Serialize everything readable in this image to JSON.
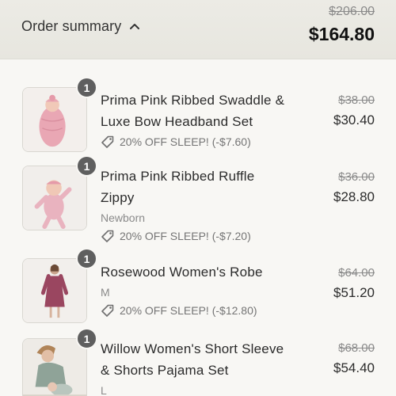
{
  "header": {
    "summary_label": "Order summary",
    "original_total": "$206.00",
    "total": "$164.80"
  },
  "items": [
    {
      "quantity": "1",
      "name_line1": "Prima Pink Ribbed Swaddle &",
      "name_line2": "Luxe Bow Headband Set",
      "variant": "",
      "discount": "20% OFF SLEEP! (-$7.60)",
      "original_price": "$38.00",
      "price": "$30.40"
    },
    {
      "quantity": "1",
      "name_line1": "Prima Pink Ribbed Ruffle",
      "name_line2": "Zippy",
      "variant": "Newborn",
      "discount": "20% OFF SLEEP! (-$7.20)",
      "original_price": "$36.00",
      "price": "$28.80"
    },
    {
      "quantity": "1",
      "name_line1": "Rosewood Women's Robe",
      "name_line2": "",
      "variant": "M",
      "discount": "20% OFF SLEEP! (-$12.80)",
      "original_price": "$64.00",
      "price": "$51.20"
    },
    {
      "quantity": "1",
      "name_line1": "Willow Women's Short Sleeve",
      "name_line2": "& Shorts Pajama Set",
      "variant": "L",
      "discount": "",
      "original_price": "$68.00",
      "price": "$54.40"
    }
  ],
  "icons": {
    "chevron": "chevron-up-icon",
    "tag": "tag-icon"
  },
  "colors": {
    "header_bg": "#e9e8e2",
    "badge_bg": "#5f5f5f",
    "robe_color": "#9a4660",
    "swaddle_pink": "#e9a7b4",
    "pajama_sage": "#8fa398"
  }
}
